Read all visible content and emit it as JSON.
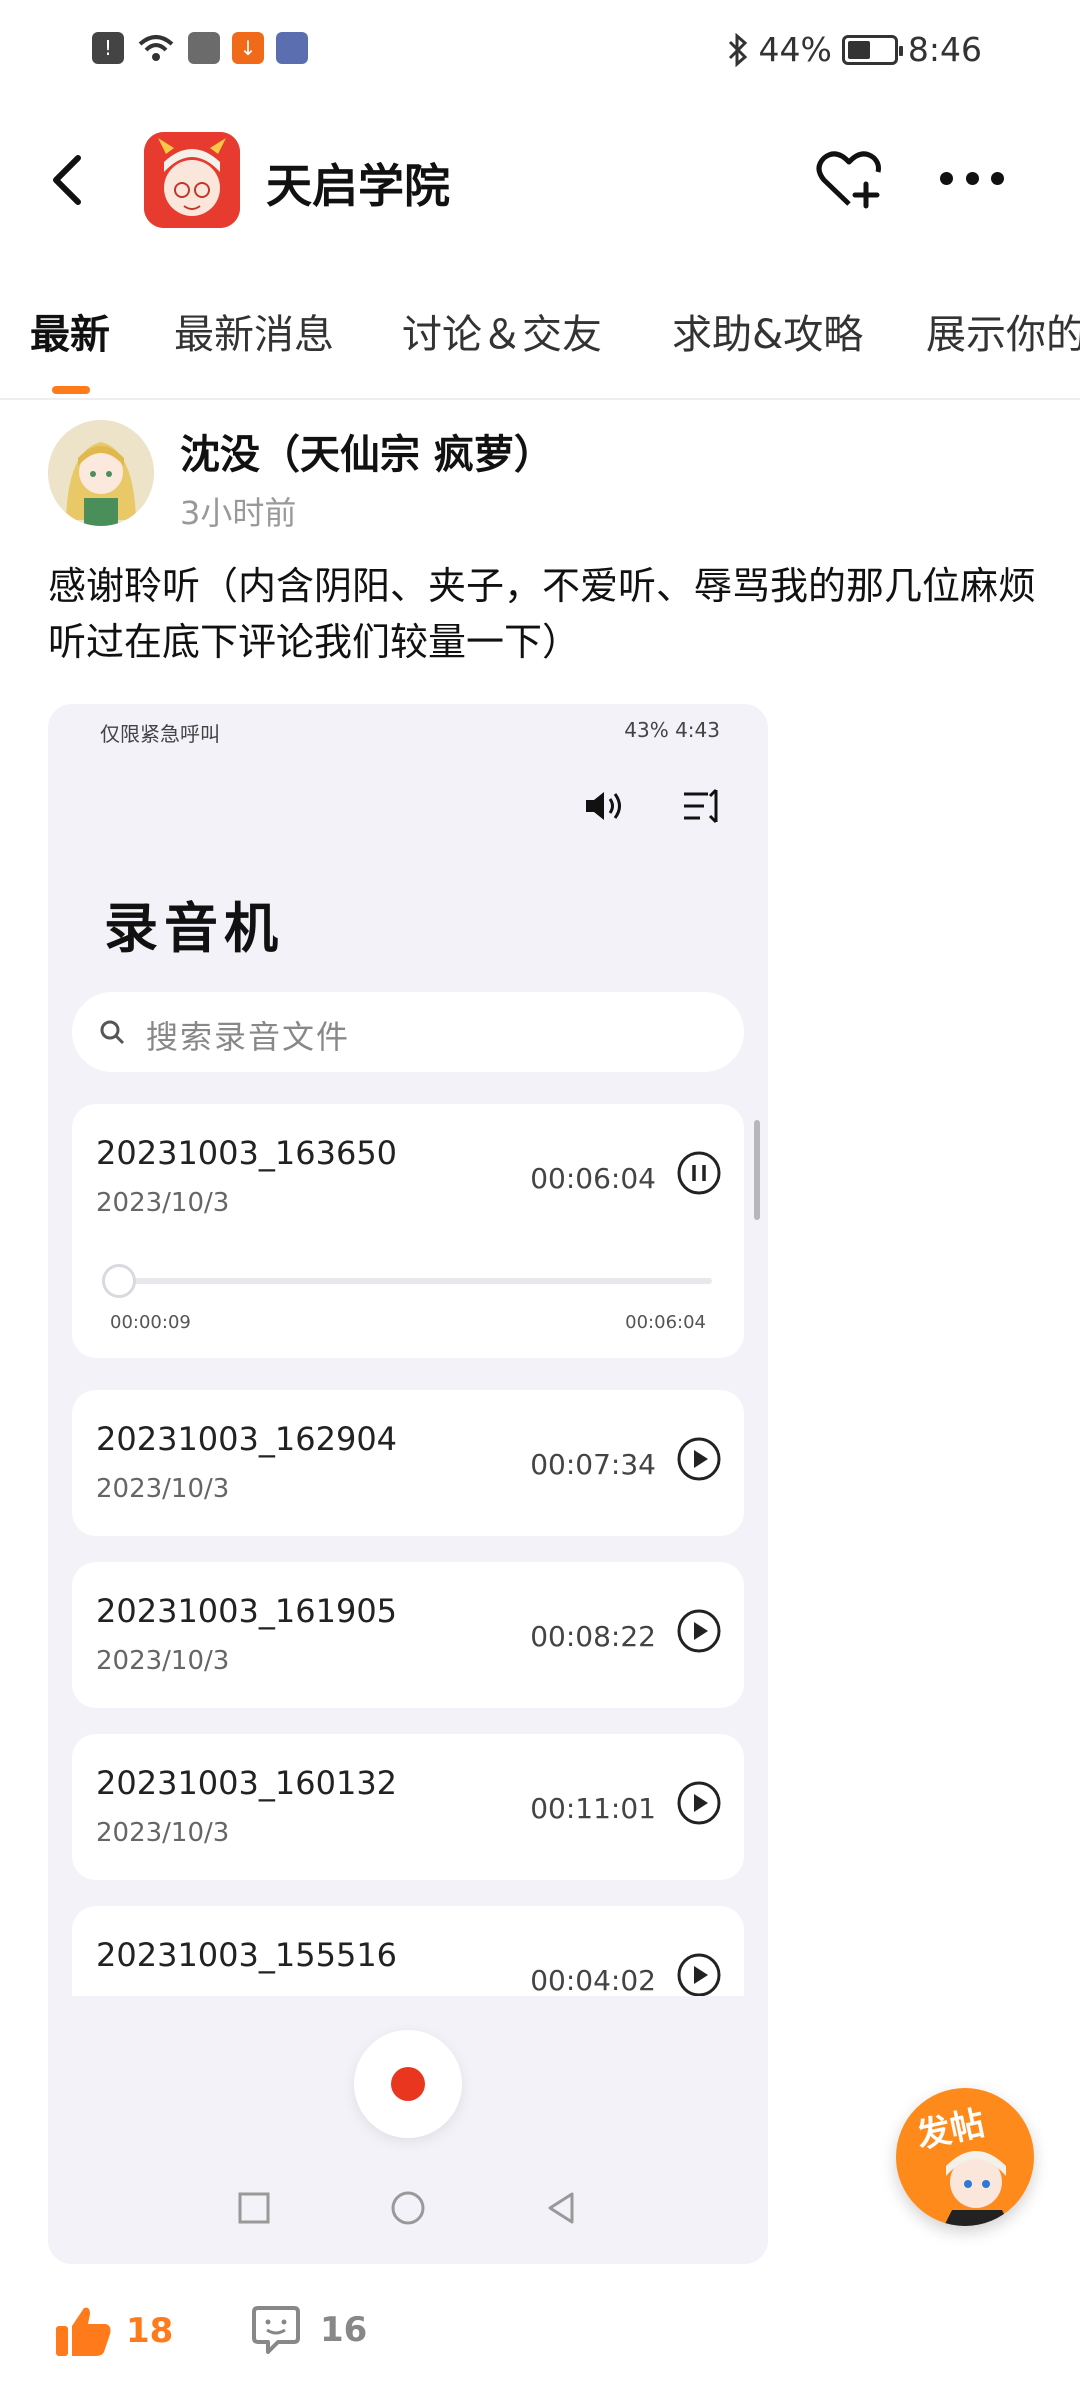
{
  "status_bar": {
    "battery_percent": "44%",
    "time": "8:46",
    "left_icons": [
      "alert-icon",
      "wifi-icon",
      "app-icon",
      "download-icon",
      "game-icon"
    ],
    "right_icons": [
      "bluetooth-icon",
      "battery-icon"
    ]
  },
  "header": {
    "title": "天启学院",
    "icons": [
      "back-icon",
      "heart-add-icon",
      "more-icon"
    ]
  },
  "tabs": [
    {
      "label": "最新",
      "active": true
    },
    {
      "label": "最新消息",
      "active": false
    },
    {
      "label": "讨论＆交友",
      "active": false
    },
    {
      "label": "求助&攻略",
      "active": false
    },
    {
      "label": "展示你的",
      "active": false
    }
  ],
  "post": {
    "author": "沈没（天仙宗 疯萝）",
    "time": "3小时前",
    "text": "感谢聆听（内含阴阳、夹子，不爱听、辱骂我的那几位麻烦听过在底下评论我们较量一下）",
    "likes": "18",
    "comments": "16"
  },
  "screenshot": {
    "status_left": "仅限紧急呼叫",
    "status_right": "43%",
    "status_time": "4:43",
    "title": "录音机",
    "search_placeholder": "搜索录音文件",
    "recordings": [
      {
        "name": "20231003_163650",
        "date": "2023/10/3",
        "duration": "00:06:04",
        "playing": true,
        "position": "00:00:09",
        "length": "00:06:04"
      },
      {
        "name": "20231003_162904",
        "date": "2023/10/3",
        "duration": "00:07:34",
        "playing": false
      },
      {
        "name": "20231003_161905",
        "date": "2023/10/3",
        "duration": "00:08:22",
        "playing": false
      },
      {
        "name": "20231003_160132",
        "date": "2023/10/3",
        "duration": "00:11:01",
        "playing": false
      },
      {
        "name": "20231003_155516",
        "date": "",
        "duration": "00:04:02",
        "playing": false
      }
    ]
  },
  "fab": {
    "label": "发帖"
  },
  "colors": {
    "accent": "#ff7a1a",
    "record_red": "#e8361f",
    "app_icon_bg": "#e63b2e"
  }
}
